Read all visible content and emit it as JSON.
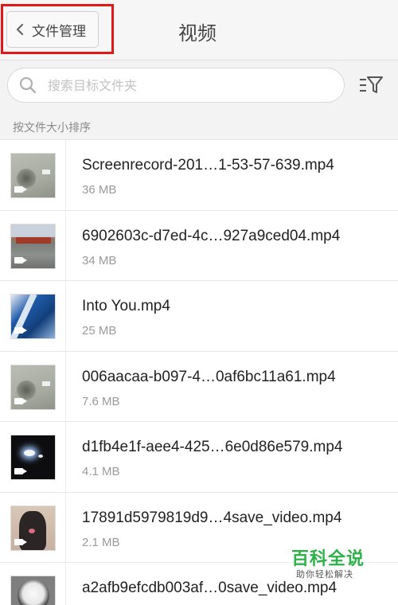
{
  "header": {
    "back_label": "文件管理",
    "title": "视频"
  },
  "search": {
    "placeholder": "搜索目标文件夹",
    "value": ""
  },
  "sort": {
    "label": "按文件大小排序"
  },
  "files": [
    {
      "name": "Screenrecord-201…1-53-57-639.mp4",
      "size": "36 MB"
    },
    {
      "name": "6902603c-d7ed-4c…927a9ced04.mp4",
      "size": "34 MB"
    },
    {
      "name": "Into You.mp4",
      "size": "25 MB"
    },
    {
      "name": "006aacaa-b097-4…0af6bc11a61.mp4",
      "size": "7.6 MB"
    },
    {
      "name": "d1fb4e1f-aee4-425…6e0d86e579.mp4",
      "size": "4.1 MB"
    },
    {
      "name": "17891d5979819d9…4save_video.mp4",
      "size": "2.1 MB"
    },
    {
      "name": "a2afb9efcdb003af…0save_video.mp4",
      "size": ""
    }
  ],
  "watermark": {
    "brand": "百科全说",
    "tagline": "助你轻松解决"
  },
  "colors": {
    "highlight": "#e01818",
    "watermark_green": "#2db24a"
  },
  "icons": [
    "chevron-left-icon",
    "search-icon",
    "filter-icon",
    "video-camera-icon"
  ]
}
